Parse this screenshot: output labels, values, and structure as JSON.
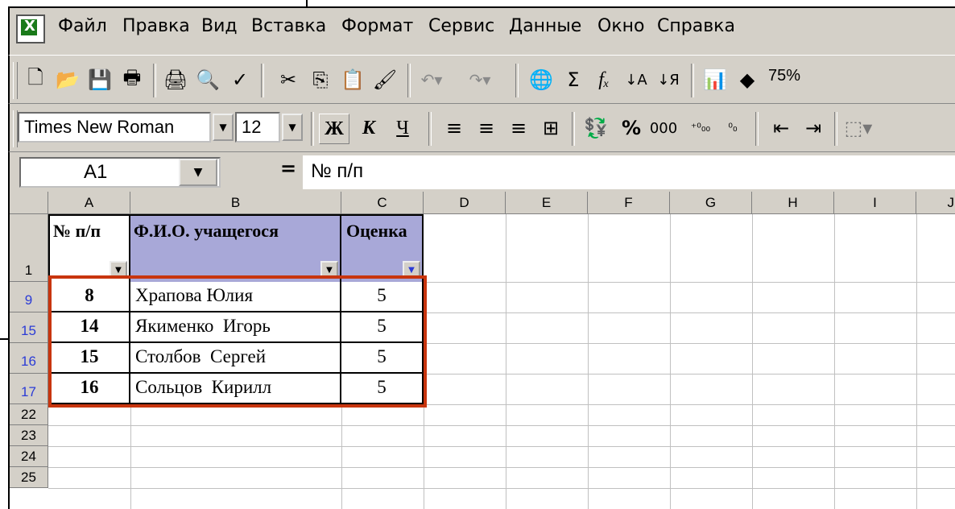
{
  "menu": {
    "items": [
      {
        "label": "Файл",
        "u": "Ф"
      },
      {
        "label": "Правка",
        "u": "П"
      },
      {
        "label": "Вид",
        "u": "В"
      },
      {
        "label": "Вставка",
        "u": "а"
      },
      {
        "label": "Формат",
        "u": "м"
      },
      {
        "label": "Сервис",
        "u": "е"
      },
      {
        "label": "Данные",
        "u": "Д"
      },
      {
        "label": "Окно",
        "u": "О"
      },
      {
        "label": "Справка",
        "u": "С"
      }
    ]
  },
  "toolbar": {
    "zoom": "75%",
    "font_name": "Times New Roman",
    "font_size": "12",
    "bold": "Ж",
    "italic": "К",
    "underline": "Ч",
    "percent": "%",
    "thousands": "000",
    "inc_decimal": "⁺⁰₀₀",
    "dec_decimal": "⁰₀",
    "sum": "Σ",
    "fx": "fₓ"
  },
  "formula_bar": {
    "cell_ref": "A1",
    "equals": "=",
    "content": "№ п/п"
  },
  "grid": {
    "columns": [
      "A",
      "B",
      "C",
      "D",
      "E",
      "F",
      "G",
      "H",
      "I",
      "J"
    ],
    "header_row_number": "1",
    "headers": {
      "a": "№ п/п",
      "b": "Ф.И.О. учащегося",
      "c": "Оценка"
    },
    "rows": [
      {
        "row": "9",
        "num": "8",
        "name": "Храпова Юлия",
        "grade": "5"
      },
      {
        "row": "15",
        "num": "14",
        "name": "Якименко  Игорь",
        "grade": "5"
      },
      {
        "row": "16",
        "num": "15",
        "name": "Столбов  Сергей",
        "grade": "5"
      },
      {
        "row": "17",
        "num": "16",
        "name": "Сольцов  Кирилл",
        "grade": "5"
      }
    ],
    "empty_rows": [
      "22",
      "23",
      "24",
      "25"
    ]
  },
  "colors": {
    "chrome": "#d4d0c8",
    "header_fill": "#a8a8d8",
    "selection": "#c8350e",
    "filtered_row_number": "#2b3bd6"
  },
  "icons": [
    "excel-app-icon",
    "new-icon",
    "open-icon",
    "save-icon",
    "permission-icon",
    "print-icon",
    "print-preview-icon",
    "spelling-icon",
    "cut-icon",
    "copy-icon",
    "paste-icon",
    "format-painter-icon",
    "undo-icon",
    "redo-icon",
    "hyperlink-icon",
    "autosum-icon",
    "function-icon",
    "sort-ascending-icon",
    "sort-descending-icon",
    "chart-wizard-icon",
    "drawing-icon",
    "align-left-icon",
    "center-icon",
    "align-right-icon",
    "merge-center-icon",
    "currency-icon",
    "decrease-indent-icon",
    "increase-indent-icon",
    "borders-icon"
  ]
}
